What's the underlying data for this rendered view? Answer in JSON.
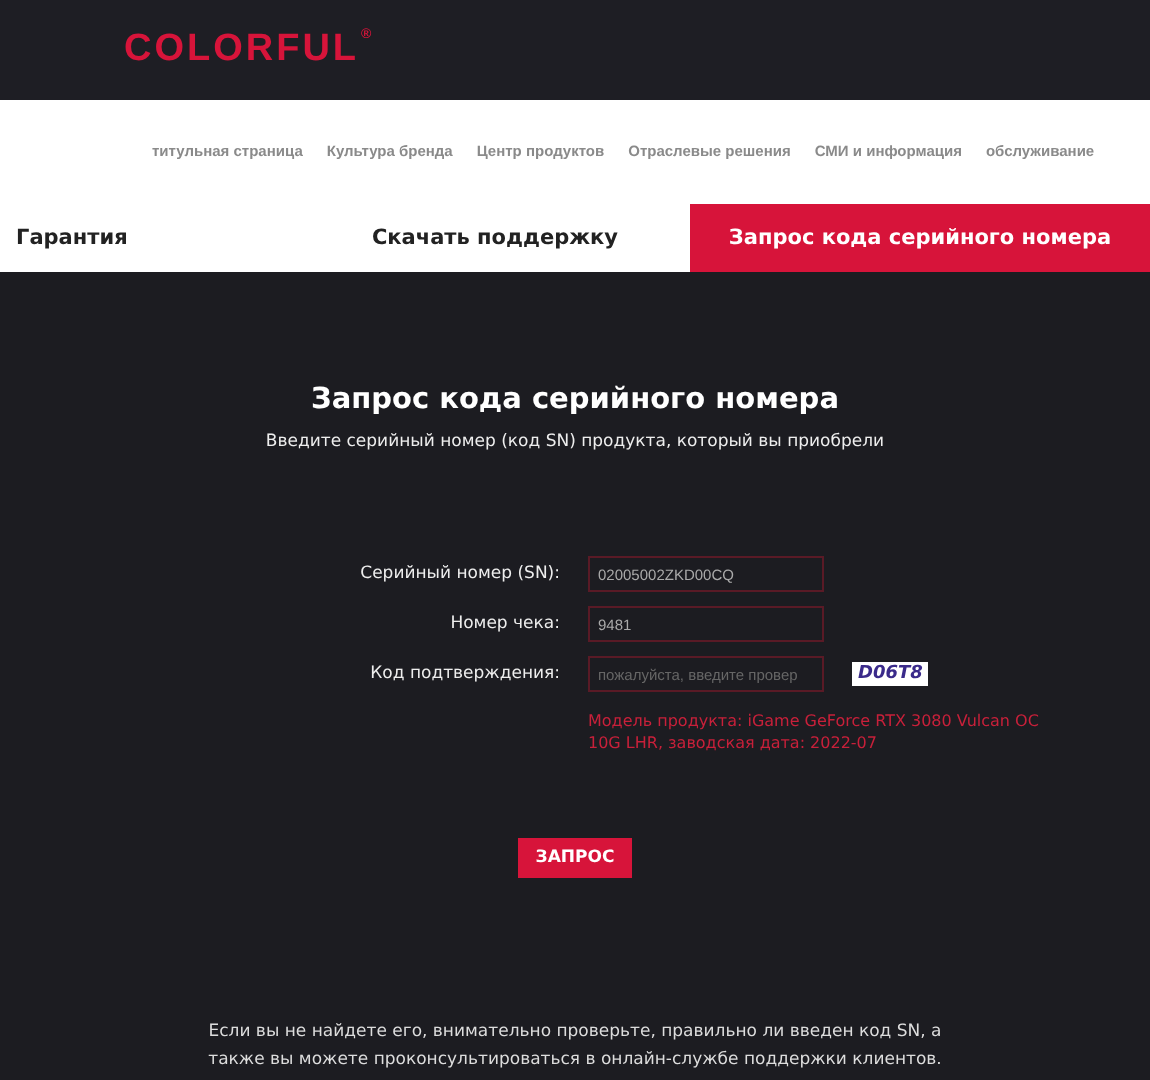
{
  "logo": {
    "text": "COLORFUL",
    "mark": "®"
  },
  "nav": [
    "титульная страница",
    "Культура бренда",
    "Центр продуктов",
    "Отраслевые решения",
    "СМИ и информация",
    "обслуживание"
  ],
  "tabs": [
    {
      "label": "Гарантия",
      "selected": false
    },
    {
      "label": "Скачать поддержку",
      "selected": false
    },
    {
      "label": "Запрос кода серийного номера",
      "selected": true
    }
  ],
  "title": "Запрос кода серийного номера",
  "subtitle": "Введите серийный номер (код SN) продукта, который вы приобрели",
  "fields": [
    {
      "label": "Серийный номер (SN):",
      "value": "02005002ZKD00CQ"
    },
    {
      "label": "Номер чека:",
      "value": "9481"
    },
    {
      "label": "Код подтверждения:",
      "placeholder": "пожалуйста, введите провер",
      "captcha": "D06T8"
    }
  ],
  "result": "Модель продукта: iGame GeForce RTX 3080 Vulcan OC 10G LHR, заводская дата: 2022-07",
  "button": "ЗАПРОС",
  "footer": "Если вы не найдете его, внимательно проверьте, правильно ли введен код SN, а также вы можете проконсультироваться в онлайн-службе поддержки клиентов."
}
